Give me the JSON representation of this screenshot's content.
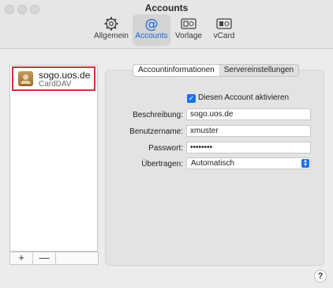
{
  "window": {
    "title": "Accounts"
  },
  "toolbar": {
    "items": [
      {
        "label": "Allgemein",
        "icon": "gear-icon",
        "active": false
      },
      {
        "label": "Accounts",
        "icon": "at-sign-icon",
        "active": true
      },
      {
        "label": "Vorlage",
        "icon": "template-card-icon",
        "active": false
      },
      {
        "label": "vCard",
        "icon": "vcard-icon",
        "active": false
      }
    ]
  },
  "accounts": [
    {
      "name": "sogo.uos.de",
      "type": "CardDAV",
      "selected": true
    }
  ],
  "list_buttons": {
    "add": "+",
    "remove": "—"
  },
  "tabs": [
    {
      "label": "Accountinformationen",
      "active": true
    },
    {
      "label": "Servereinstellungen",
      "active": false
    }
  ],
  "form": {
    "enable_label": "Diesen Account aktivieren",
    "enabled": true,
    "description_label": "Beschreibung:",
    "description_value": "sogo.uos.de",
    "username_label": "Benutzername:",
    "username_value": "xmuster",
    "password_label": "Passwort:",
    "password_value": "••••••••",
    "transfer_label": "Übertragen:",
    "transfer_value": "Automatisch"
  },
  "help_label": "?",
  "colors": {
    "accent": "#1a73e8",
    "selection_outline": "#d0323b"
  }
}
